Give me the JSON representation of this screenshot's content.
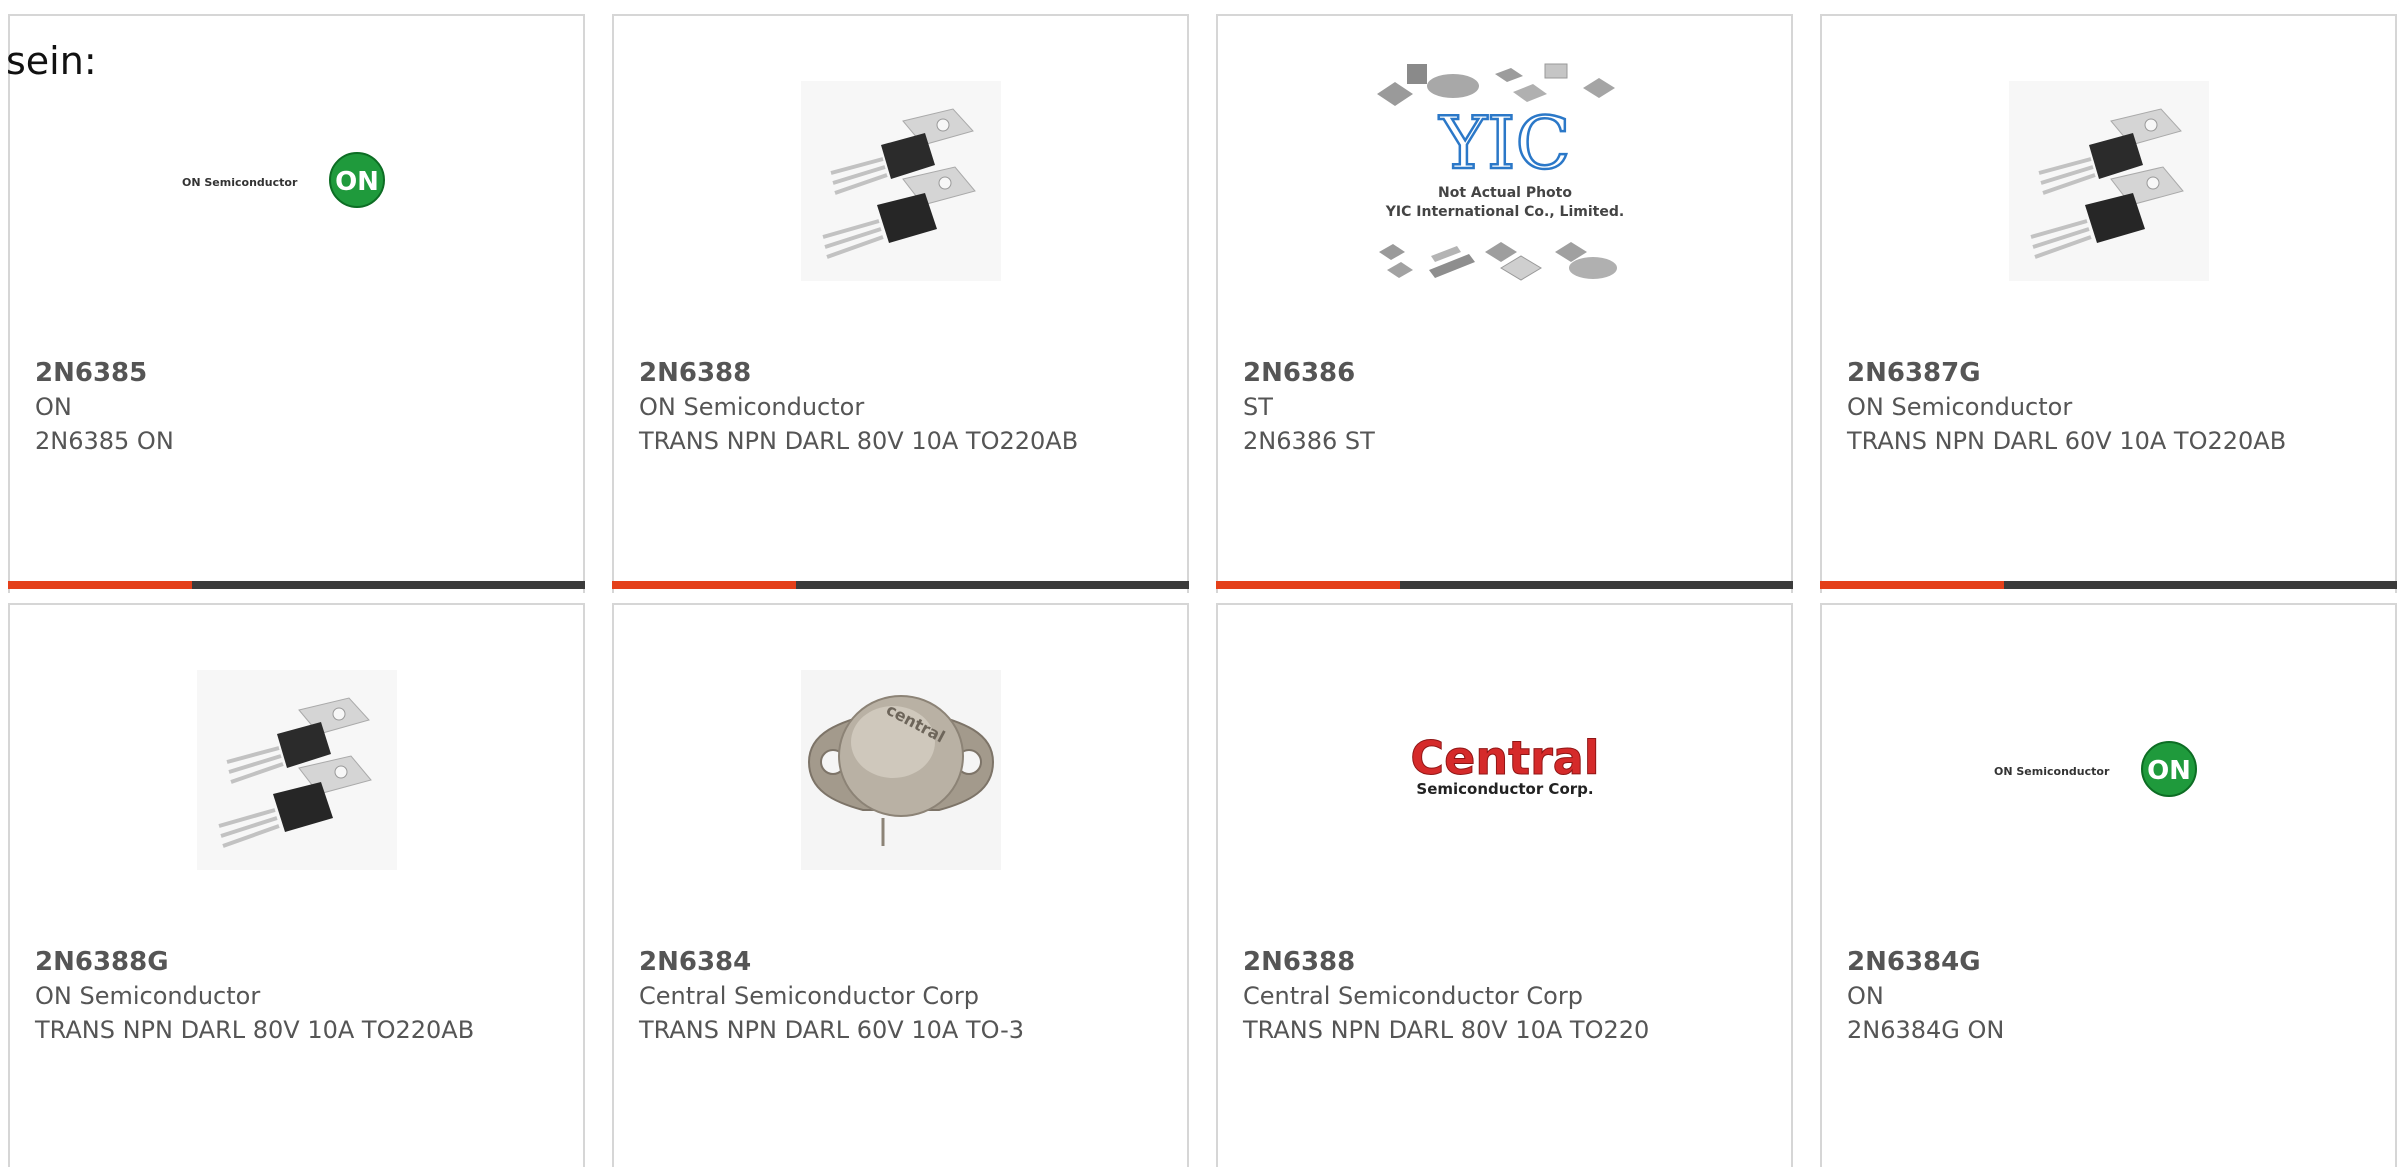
{
  "intro_text": "sein:",
  "colors": {
    "accent_bar": "#e4401a",
    "dark_bar": "#3b3b3b",
    "card_border": "#d6d6d6",
    "text": "#555555"
  },
  "products": [
    {
      "part": "2N6385",
      "maker": "ON",
      "desc": "2N6385 ON",
      "image": "on-semiconductor-logo",
      "logo_text": "ON Semiconductor",
      "logo_mark": "ON"
    },
    {
      "part": "2N6388",
      "maker": "ON Semiconductor",
      "desc": "TRANS NPN DARL 80V 10A TO220AB",
      "image": "to220-transistors-photo"
    },
    {
      "part": "2N6386",
      "maker": "ST",
      "desc": "2N6386 ST",
      "image": "yic-placeholder",
      "logo_mark": "YIC",
      "caption_line1": "Not Actual Photo",
      "caption_line2": "YIC International Co., Limited."
    },
    {
      "part": "2N6387G",
      "maker": "ON Semiconductor",
      "desc": "TRANS NPN DARL 60V 10A TO220AB",
      "image": "to220-transistors-photo"
    },
    {
      "part": "2N6388G",
      "maker": "ON Semiconductor",
      "desc": "TRANS NPN DARL 80V 10A TO220AB",
      "image": "to220-transistors-photo"
    },
    {
      "part": "2N6384",
      "maker": "Central Semiconductor Corp",
      "desc": "TRANS NPN DARL 60V 10A TO-3",
      "image": "to3-transistor-photo",
      "engraving": "central"
    },
    {
      "part": "2N6388",
      "maker": "Central Semiconductor Corp",
      "desc": "TRANS NPN DARL 80V 10A TO220",
      "image": "central-semiconductor-logo",
      "logo_text": "Central",
      "logo_sub": "Semiconductor Corp."
    },
    {
      "part": "2N6384G",
      "maker": "ON",
      "desc": "2N6384G ON",
      "image": "on-semiconductor-logo",
      "logo_text": "ON Semiconductor",
      "logo_mark": "ON"
    }
  ]
}
